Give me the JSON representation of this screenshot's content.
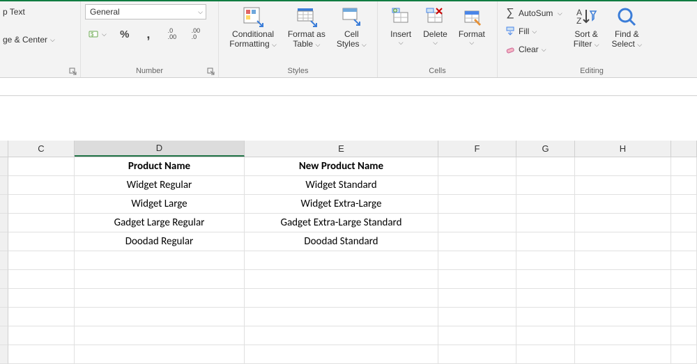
{
  "ribbon": {
    "alignment": {
      "wrap_text": "p Text",
      "merge_center": "ge & Center"
    },
    "number": {
      "format_selected": "General",
      "group_label": "Number"
    },
    "styles": {
      "conditional": "Conditional",
      "formatting": "Formatting",
      "format_as": "Format as",
      "table": "Table",
      "cell": "Cell",
      "styles_word": "Styles",
      "group_label": "Styles"
    },
    "cells": {
      "insert": "Insert",
      "delete": "Delete",
      "format": "Format",
      "group_label": "Cells"
    },
    "editing": {
      "autosum": "AutoSum",
      "fill": "Fill",
      "clear": "Clear",
      "sort": "Sort &",
      "filter": "Filter",
      "find": "Find &",
      "select": "Select",
      "group_label": "Editing"
    }
  },
  "columns": {
    "c": "C",
    "d": "D",
    "e": "E",
    "f": "F",
    "g": "G",
    "h": "H"
  },
  "grid": {
    "r1": {
      "d": "Product Name",
      "e": "New Product Name"
    },
    "r2": {
      "d": "Widget Regular",
      "e": "Widget Standard"
    },
    "r3": {
      "d": "Widget Large",
      "e": "Widget Extra-Large"
    },
    "r4": {
      "d": "Gadget Large Regular",
      "e": "Gadget Extra-Large Standard"
    },
    "r5": {
      "d": "Doodad Regular",
      "e": "Doodad Standard"
    }
  }
}
